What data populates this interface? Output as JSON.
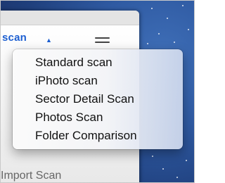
{
  "window": {
    "scan_link_label": "scan",
    "bottom_text": "Import Scan"
  },
  "icons": {
    "caret": "triangle-up-icon",
    "menu": "hamburger-icon"
  },
  "context_menu": {
    "items": [
      {
        "label": "Standard scan"
      },
      {
        "label": "iPhoto scan"
      },
      {
        "label": "Sector Detail Scan"
      },
      {
        "label": "Photos Scan"
      },
      {
        "label": "Folder Comparison"
      }
    ]
  }
}
